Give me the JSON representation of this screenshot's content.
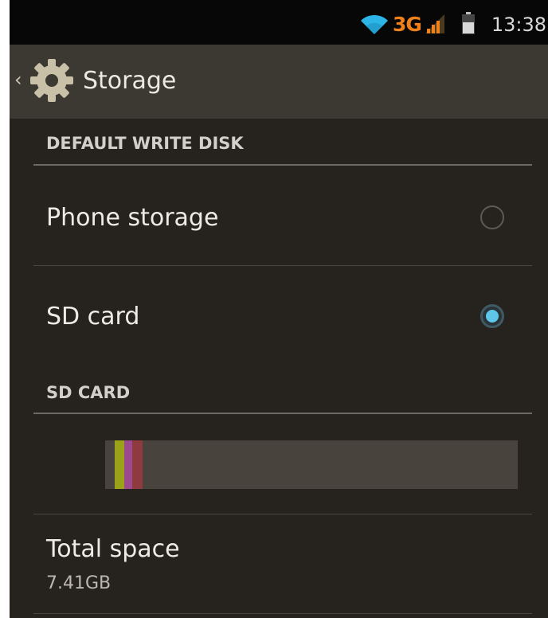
{
  "status_bar": {
    "network": "3G",
    "time": "13:38"
  },
  "action_bar": {
    "title": "Storage"
  },
  "default_write_disk": {
    "header": "DEFAULT WRITE DISK",
    "options": [
      {
        "label": "Phone storage",
        "selected": false
      },
      {
        "label": "SD card",
        "selected": true
      }
    ]
  },
  "sd_card": {
    "header": "SD CARD",
    "usage_segments": [
      {
        "color": "#9aa21a",
        "fraction": 0.023
      },
      {
        "color": "#9b4a8e",
        "fraction": 0.02
      },
      {
        "color": "#8e3a3f",
        "fraction": 0.025
      }
    ],
    "total_space_label": "Total space",
    "total_space_value": "7.41GB"
  },
  "colors": {
    "accent": "#5ec6e6",
    "network_3g": "#f0801a",
    "background": "#26231e"
  }
}
